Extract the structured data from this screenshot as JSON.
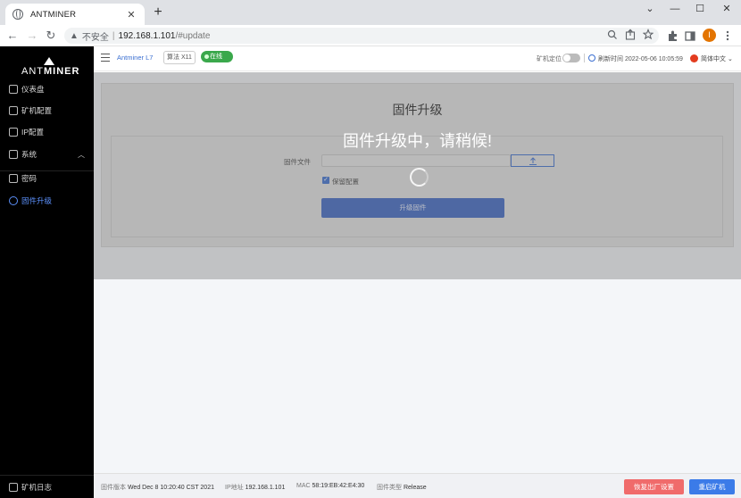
{
  "browser": {
    "tab_title": "ANTMINER",
    "tab_close": "✕",
    "new_tab": "+",
    "window_controls": [
      "⌄",
      "—",
      "☐",
      "✕"
    ],
    "nav": {
      "back": "←",
      "forward": "→",
      "reload": "↻"
    },
    "security_warning": "▲",
    "security_label": "不安全",
    "url_host": "192.168.1.101",
    "url_path": "/#update",
    "profile_initial": "I",
    "omnibox_icons": [
      "zoom-icon",
      "share-icon",
      "star-icon"
    ],
    "toolbar_icons": [
      "extensions-icon",
      "sidebar-icon",
      "profile-avatar",
      "menu-icon"
    ]
  },
  "sidebar": {
    "logo_ant": "ANT",
    "logo_miner": "MINER",
    "items": [
      {
        "label": "仪表盘",
        "icon": "dashboard-icon",
        "active": false
      },
      {
        "label": "矿机配置",
        "icon": "config-icon",
        "active": false
      },
      {
        "label": "IP配置",
        "icon": "network-icon",
        "active": false
      },
      {
        "label": "系统",
        "icon": "system-icon",
        "active": false,
        "expandable": true
      },
      {
        "label": "密码",
        "icon": "lock-icon",
        "active": false
      },
      {
        "label": "固件升级",
        "icon": "upgrade-icon",
        "active": true
      }
    ],
    "footer_label": "矿机日志"
  },
  "header": {
    "model": "Antminer L7",
    "model_tag": "算法 X11",
    "online": "在线",
    "locate_label": "矿机定位",
    "refresh_label": "刷新时间",
    "refresh_time": "2022-05-06 10:05:59",
    "language": "简体中文"
  },
  "upgrade": {
    "title": "固件升级",
    "overlay_message": "固件升级中，请稍候!",
    "file_label": "固件文件",
    "upload_icon": "upload-icon",
    "keep_settings_label": "保留配置",
    "keep_settings_checked": true,
    "submit_label": "升级固件"
  },
  "status": {
    "firmware_label": "固件版本",
    "firmware_value": "Wed Dec 8 10:20:40 CST 2021",
    "ip_label": "IP地址",
    "ip_value": "192.168.1.101",
    "mac_label": "MAC",
    "mac_value": "58:19:EB:42:E4:30",
    "fw_type_label": "固件类型",
    "fw_type_value": "Release",
    "reset_button": "恢复出厂设置",
    "reboot_button": "重启矿机"
  },
  "colors": {
    "accent": "#3b6fd1",
    "online": "#3aa84b",
    "danger": "#f06b6b",
    "sidebar_bg": "#000000"
  }
}
